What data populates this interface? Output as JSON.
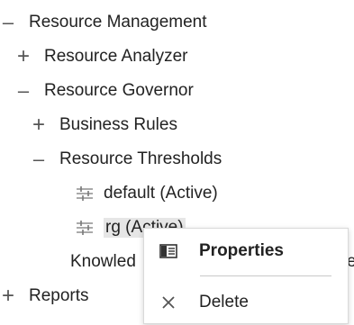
{
  "tree": {
    "resource_management": "Resource Management",
    "resource_analyzer": "Resource Analyzer",
    "resource_governor": "Resource Governor",
    "business_rules": "Business Rules",
    "resource_thresholds": "Resource Thresholds",
    "default_threshold": "default (Active)",
    "rg_threshold": "rg (Active)",
    "knowledge_partial": "Knowled",
    "knowledge_tail": "e",
    "reports": "Reports",
    "expanded_glyph": "–",
    "collapsed_glyph": "+"
  },
  "context_menu": {
    "properties_label": "Properties",
    "delete_label": "Delete",
    "properties_icon": "properties-panel-icon",
    "delete_icon": "close-x-icon"
  },
  "colors": {
    "selected_bg": "#e6e6e6",
    "icon_gray": "#777777"
  }
}
